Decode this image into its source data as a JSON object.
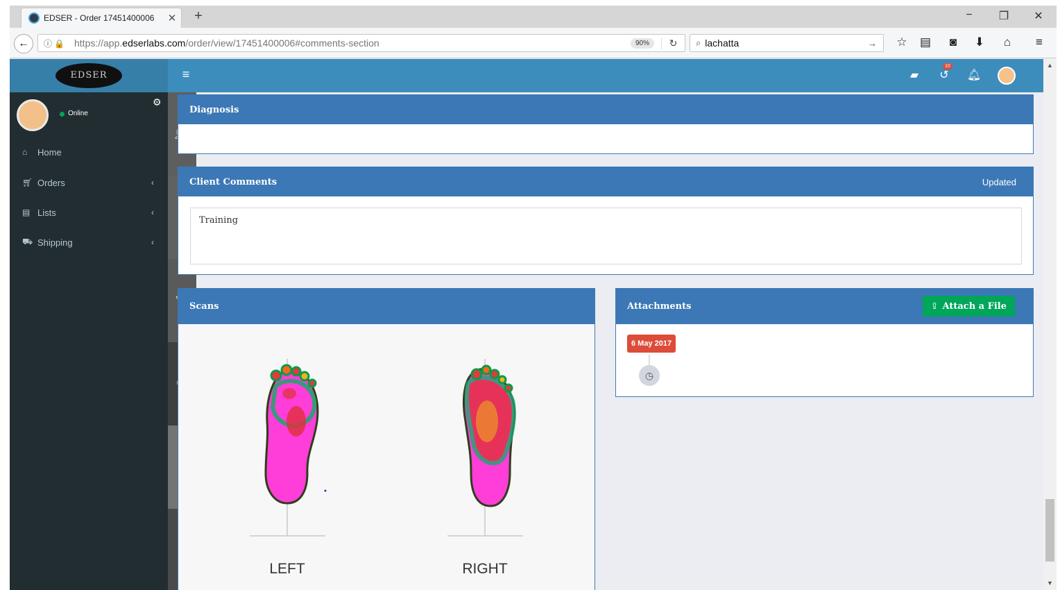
{
  "browser": {
    "tab_title": "EDSER - Order 17451400006",
    "tab_close": "✕",
    "new_tab": "+",
    "url_prefix": "https://app.",
    "url_domain": "edserlabs.com",
    "url_path": "/order/view/17451400006#comments-section",
    "zoom": "90%",
    "search_query": "lachatta"
  },
  "app": {
    "logo_text": "EDSER",
    "user_status": "Online",
    "notification_count": "10"
  },
  "sidebar": {
    "items": [
      {
        "label": "Home",
        "icon": "home-icon",
        "has_caret": false
      },
      {
        "label": "Orders",
        "icon": "cart-icon",
        "has_caret": true
      },
      {
        "label": "Lists",
        "icon": "document-icon",
        "has_caret": true
      },
      {
        "label": "Shipping",
        "icon": "truck-icon",
        "has_caret": true
      }
    ]
  },
  "panels": {
    "diagnosis": {
      "title": "Diagnosis"
    },
    "client_comments": {
      "title": "Client Comments",
      "status": "Updated",
      "comment_value": "Training"
    },
    "scans": {
      "title": "Scans",
      "left_label": "LEFT",
      "right_label": "RIGHT"
    },
    "attachments": {
      "title": "Attachments",
      "button_label": "Attach a File",
      "date": "6 May 2017"
    }
  },
  "colors": {
    "header": "#3c8dbc",
    "panel_header": "#3c78b5",
    "sidebar": "#222d32",
    "success": "#00a65a",
    "danger": "#dd4b39"
  }
}
